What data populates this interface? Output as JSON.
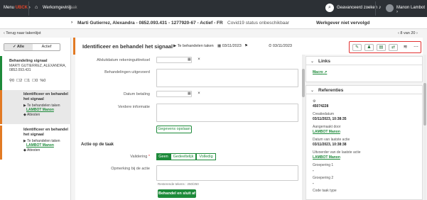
{
  "topbar": {
    "menu_label": "Menu",
    "menu_brand": "UBCK",
    "crumb1": "Werkomgeving",
    "crumb2": "Taak",
    "search_label": "Geavanceerd zoeken",
    "user": "Manon Lambot"
  },
  "case": {
    "name": "Marti Gutierrez, Alexandra - 0852.093.431 - 1277920-67 - Actief - FR",
    "covid": "Covid19 status onbeschikbaar",
    "werkgever": "Werkgever niet vervolgd"
  },
  "nav": {
    "back": "Terug naar takenlijst",
    "pager": "8 van 20"
  },
  "filter": {
    "all": "Alle",
    "active": "Actief"
  },
  "signal": {
    "title": "Behandeling signaal",
    "line1": "MARTI GUTIERREZ, ALEXANDRA,",
    "line2": "0852.093.431",
    "counts": [
      "0",
      "2",
      "1",
      "0",
      "0"
    ]
  },
  "tasks": [
    {
      "title": "Identificeer en behandel het signaal",
      "status": "Te behandelen taken",
      "user": "LAMBOT Manon",
      "attach": "Attesten"
    },
    {
      "title": "Identificeer en behandel het signaal",
      "status": "Te behandelen taken",
      "user": "LAMBOT Manon",
      "attach": "Attesten"
    }
  ],
  "task_header": {
    "title": "Identificeer en behandel het signaal",
    "status": "Te behandelen taken",
    "date1": "03/11/2023",
    "date2": "03/11/2023"
  },
  "form": {
    "afsluitdatum": "Afsluitdatum rekeninguittreksel",
    "behandelingen": "Behandelingen uitgevoerd",
    "datum_betaling": "Datum betaling",
    "verdere_info": "Verdere informatie",
    "save_btn": "Gegevens opslaan",
    "section_action": "Actie op de taak",
    "validering": "Validering",
    "seg_geen": "Geen",
    "seg_gedeeltelijk": "Gedeeltelijk",
    "seg_volledig": "Volledig",
    "opmerking": "Opmerking bij de actie",
    "remaining": "Resterende tekens : 250/250",
    "submit_btn": "Behandel en sluit af"
  },
  "links_panel": {
    "title": "Links",
    "link": "Macro"
  },
  "ref_panel": {
    "title": "Referenties",
    "id": "45074228",
    "creatiedatum_label": "Creatiedatum",
    "creatiedatum": "03/11/2023, 10:38:35",
    "aangemaakt_label": "Aangemaakt door",
    "aangemaakt": "LAMBOT Manon",
    "laatste_label": "Datum van laatste actie",
    "laatste": "03/11/2023, 10:38:38",
    "uitvoerder_label": "Uitvoerder van de laatste actie",
    "uitvoerder": "LAMBOT Manon",
    "groep1_label": "Groepering 1",
    "groep1": "-",
    "groep2_label": "Groepering 2",
    "groep2": "-",
    "code_label": "Code taak type"
  },
  "colors": {
    "accent": "#1d8a3a",
    "orange": "#e27a24",
    "topbar": "#2c3035",
    "highlight": "#e23232"
  }
}
